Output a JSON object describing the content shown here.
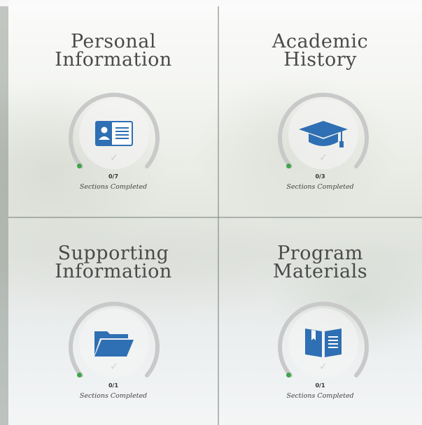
{
  "tiles": [
    {
      "title_line1": "Personal",
      "title_line2": "Information",
      "progress": "0/7",
      "progress_fraction": 0,
      "caption": "Sections Completed",
      "icon": "id-card-icon"
    },
    {
      "title_line1": "Academic",
      "title_line2": "History",
      "progress": "0/3",
      "progress_fraction": 0,
      "caption": "Sections Completed",
      "icon": "graduation-cap-icon"
    },
    {
      "title_line1": "Supporting",
      "title_line2": "Information",
      "progress": "0/1",
      "progress_fraction": 0,
      "caption": "Sections Completed",
      "icon": "folder-icon"
    },
    {
      "title_line1": "Program",
      "title_line2": "Materials",
      "progress": "0/1",
      "progress_fraction": 0,
      "caption": "Sections Completed",
      "icon": "book-icon"
    }
  ],
  "colors": {
    "icon_blue": "#2f6fb3",
    "progress_dot": "#3da54a",
    "ring": "#c9c9c9"
  }
}
